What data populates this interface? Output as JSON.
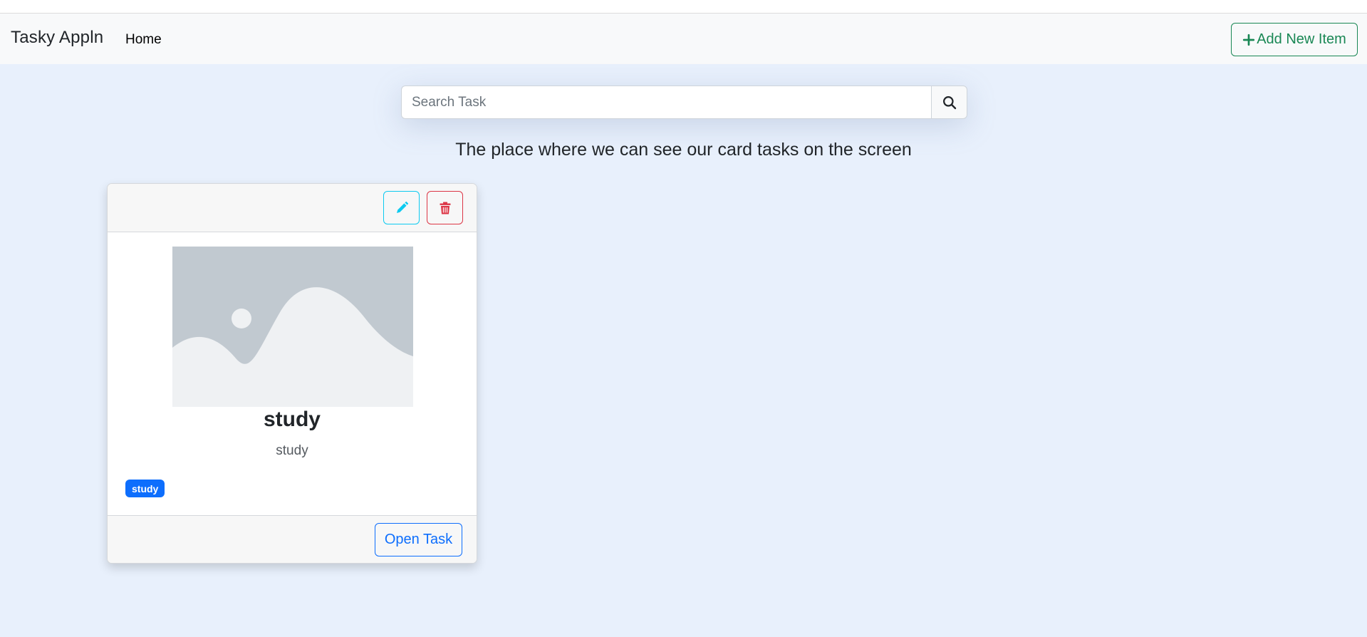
{
  "navbar": {
    "brand": "Tasky Appln",
    "home_label": "Home",
    "add_button_label": "Add New Item"
  },
  "search": {
    "placeholder": "Search Task",
    "value": "",
    "icon": "search-icon"
  },
  "main": {
    "heading": "The place where we can see our card tasks on the screen"
  },
  "cards": [
    {
      "title": "study",
      "description": "study",
      "tag": "study",
      "image": "placeholder-image",
      "edit_icon": "pencil-icon",
      "delete_icon": "trash-icon",
      "open_button_label": "Open Task"
    }
  ],
  "colors": {
    "page_background": "#e8f0fc",
    "navbar_background": "#f8f9fa",
    "success": "#198754",
    "info": "#0dcaf0",
    "danger": "#dc3545",
    "primary": "#0d6efd"
  }
}
